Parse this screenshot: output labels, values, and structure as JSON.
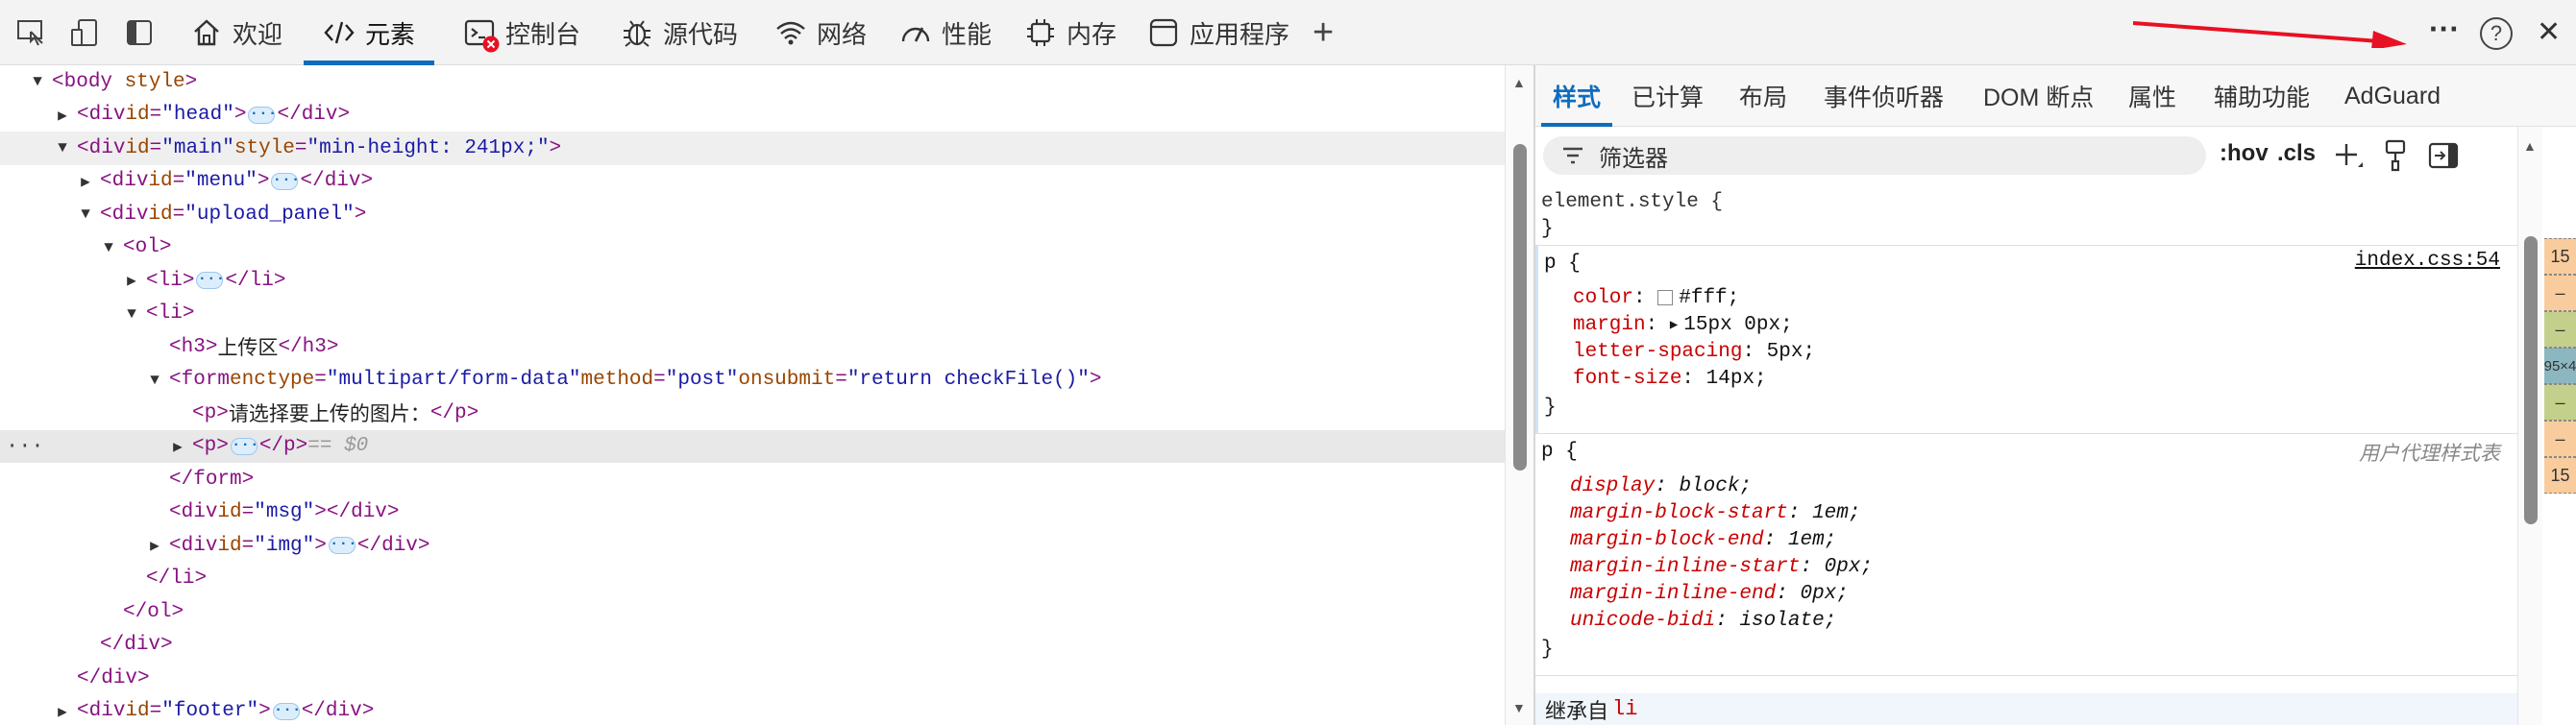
{
  "toolbar": {
    "tabs": [
      {
        "label": "欢迎",
        "icon": "home-icon"
      },
      {
        "label": "元素",
        "icon": "code-icon"
      },
      {
        "label": "控制台",
        "icon": "console-icon"
      },
      {
        "label": "源代码",
        "icon": "bug-icon"
      },
      {
        "label": "网络",
        "icon": "wifi-icon"
      },
      {
        "label": "性能",
        "icon": "gauge-icon"
      },
      {
        "label": "内存",
        "icon": "chip-icon"
      },
      {
        "label": "应用程序",
        "icon": "app-window-icon"
      }
    ],
    "add_tab": "+",
    "more": "···",
    "help": "?",
    "close": "✕",
    "accent": "#0f6cbd",
    "error_badge_color": "#e81123"
  },
  "dom": {
    "lines": [
      {
        "open": "<",
        "tag": "body",
        "a1": " style",
        "close": ">"
      },
      {
        "tag": "div",
        "attr": "id",
        "val": "\"head\""
      },
      {
        "tag": "div",
        "attr": "id",
        "val": "\"main\"",
        "attr2": "style",
        "val2": "\"min-height: 241px;\""
      },
      {
        "tag": "div",
        "attr": "id",
        "val": "\"menu\""
      },
      {
        "tag": "div",
        "attr": "id",
        "val": "\"upload_panel\""
      },
      {
        "tag": "ol"
      },
      {
        "tag": "li"
      },
      {
        "tag": "li"
      },
      {
        "tag": "h3",
        "text": "上传区"
      },
      {
        "tag": "form",
        "attr": "enctype",
        "val": "\"multipart/form-data\"",
        "attr2": "method",
        "val2": "\"post\"",
        "attr3": "onsubmit",
        "val3": "\"return checkFile()\""
      },
      {
        "tag": "p",
        "text": "请选择要上传的图片："
      },
      {
        "tag": "p",
        "dollar": "== $0"
      },
      {
        "tag": "form"
      },
      {
        "tag": "div",
        "attr": "id",
        "val": "\"msg\""
      },
      {
        "tag": "div",
        "attr": "id",
        "val": "\"img\""
      },
      {
        "tag": "li"
      },
      {
        "tag": "ol"
      },
      {
        "tag": "div"
      },
      {
        "tag": "div"
      },
      {
        "tag": "div",
        "attr": "id",
        "val": "\"footer\""
      }
    ],
    "gutter_dots": "···"
  },
  "styles_panel": {
    "tabs": [
      "样式",
      "已计算",
      "布局",
      "事件侦听器",
      "DOM 断点",
      "属性",
      "辅助功能",
      "AdGuard"
    ],
    "filter_placeholder": "筛选器",
    "hov": ":hov",
    "cls": ".cls",
    "element_style": "element.style {",
    "close_brace": "}",
    "rule1": {
      "selector": "p {",
      "source": "index.css:54",
      "props": [
        {
          "name": "color",
          "value": "#fff;"
        },
        {
          "name": "margin",
          "value": "15px 0px;"
        },
        {
          "name": "letter-spacing",
          "value": "5px;"
        },
        {
          "name": "font-size",
          "value": "14px;"
        }
      ]
    },
    "rule2": {
      "selector": "p {",
      "source": "用户代理样式表",
      "props": [
        {
          "name": "display",
          "value": "block;"
        },
        {
          "name": "margin-block-start",
          "value": "1em;"
        },
        {
          "name": "margin-block-end",
          "value": "1em;"
        },
        {
          "name": "margin-inline-start",
          "value": "0px;"
        },
        {
          "name": "margin-inline-end",
          "value": "0px;"
        },
        {
          "name": "unicode-bidi",
          "value": "isolate;"
        }
      ]
    },
    "inherited_label": "继承自",
    "inherited_from": "li"
  },
  "box_model": {
    "cells": [
      "15",
      "–",
      "–",
      "95×4",
      "–",
      "–",
      "15"
    ]
  }
}
